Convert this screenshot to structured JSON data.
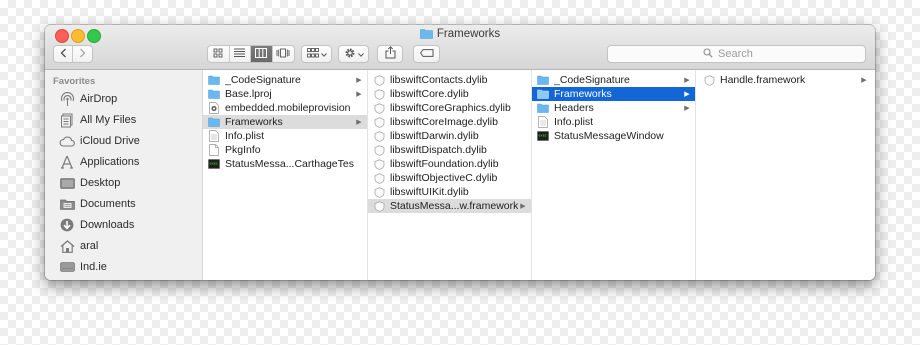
{
  "window": {
    "title": "Frameworks",
    "folder_color": "#6cb8ee",
    "selection_blue": "#1366d6"
  },
  "toolbar": {
    "back_icon": "chevron-left-icon",
    "forward_icon": "chevron-right-icon",
    "view_modes": [
      "icon-view-icon",
      "list-view-icon",
      "column-view-icon",
      "cover-flow-icon"
    ],
    "active_view": "column-view-icon",
    "arrange_icon": "grid-arrange-icon",
    "action_icon": "gear-icon",
    "share_icon": "share-icon",
    "tag_icon": "tag-icon",
    "search_placeholder": "Search"
  },
  "sidebar": {
    "header": "Favorites",
    "items": [
      {
        "label": "AirDrop",
        "icon": "airdrop-icon"
      },
      {
        "label": "All My Files",
        "icon": "all-files-icon"
      },
      {
        "label": "iCloud Drive",
        "icon": "cloud-icon"
      },
      {
        "label": "Applications",
        "icon": "applications-icon"
      },
      {
        "label": "Desktop",
        "icon": "desktop-icon"
      },
      {
        "label": "Documents",
        "icon": "documents-icon"
      },
      {
        "label": "Downloads",
        "icon": "downloads-icon"
      },
      {
        "label": "aral",
        "icon": "home-icon"
      },
      {
        "label": "Ind.ie",
        "icon": "drive-icon"
      }
    ]
  },
  "columns": [
    {
      "items": [
        {
          "label": "_CodeSignature",
          "icon": "folder-icon",
          "arrow": true,
          "selected": "none"
        },
        {
          "label": "Base.lproj",
          "icon": "folder-icon",
          "arrow": true,
          "selected": "none"
        },
        {
          "label": "embedded.mobileprovision",
          "icon": "provision-file-icon",
          "arrow": false,
          "selected": "none"
        },
        {
          "label": "Frameworks",
          "icon": "folder-icon",
          "arrow": true,
          "selected": "gray"
        },
        {
          "label": "Info.plist",
          "icon": "plist-file-icon",
          "arrow": false,
          "selected": "none"
        },
        {
          "label": "PkgInfo",
          "icon": "document-icon",
          "arrow": false,
          "selected": "none"
        },
        {
          "label": "StatusMessa...CarthageTest",
          "icon": "executable-icon",
          "arrow": false,
          "selected": "none"
        }
      ]
    },
    {
      "items": [
        {
          "label": "libswiftContacts.dylib",
          "icon": "dylib-icon",
          "arrow": false,
          "selected": "none"
        },
        {
          "label": "libswiftCore.dylib",
          "icon": "dylib-icon",
          "arrow": false,
          "selected": "none"
        },
        {
          "label": "libswiftCoreGraphics.dylib",
          "icon": "dylib-icon",
          "arrow": false,
          "selected": "none"
        },
        {
          "label": "libswiftCoreImage.dylib",
          "icon": "dylib-icon",
          "arrow": false,
          "selected": "none"
        },
        {
          "label": "libswiftDarwin.dylib",
          "icon": "dylib-icon",
          "arrow": false,
          "selected": "none"
        },
        {
          "label": "libswiftDispatch.dylib",
          "icon": "dylib-icon",
          "arrow": false,
          "selected": "none"
        },
        {
          "label": "libswiftFoundation.dylib",
          "icon": "dylib-icon",
          "arrow": false,
          "selected": "none"
        },
        {
          "label": "libswiftObjectiveC.dylib",
          "icon": "dylib-icon",
          "arrow": false,
          "selected": "none"
        },
        {
          "label": "libswiftUIKit.dylib",
          "icon": "dylib-icon",
          "arrow": false,
          "selected": "none"
        },
        {
          "label": "StatusMessa...w.framework",
          "icon": "framework-icon",
          "arrow": true,
          "selected": "gray"
        }
      ]
    },
    {
      "items": [
        {
          "label": "_CodeSignature",
          "icon": "folder-icon",
          "arrow": true,
          "selected": "none"
        },
        {
          "label": "Frameworks",
          "icon": "folder-icon",
          "arrow": true,
          "selected": "blue"
        },
        {
          "label": "Headers",
          "icon": "folder-icon",
          "arrow": true,
          "selected": "none"
        },
        {
          "label": "Info.plist",
          "icon": "plist-file-icon",
          "arrow": false,
          "selected": "none"
        },
        {
          "label": "StatusMessageWindow",
          "icon": "executable-icon",
          "arrow": false,
          "selected": "none"
        }
      ]
    },
    {
      "items": [
        {
          "label": "Handle.framework",
          "icon": "framework-icon",
          "arrow": true,
          "selected": "none"
        }
      ]
    }
  ]
}
